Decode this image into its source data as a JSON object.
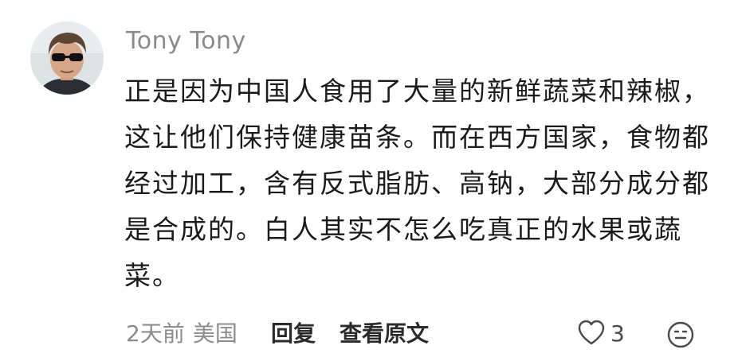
{
  "comment": {
    "username": "Tony Tony",
    "text": "正是因为中国人食用了大量的新鲜蔬菜和辣椒，这让他们保持健康苗条。而在西方国家，食物都经过加工，含有反式脂肪、高钠，大部分成分都是合成的。白人其实不怎么吃真正的水果或蔬菜。",
    "time": "2天前",
    "region": "美国",
    "reply_label": "回复",
    "view_original_label": "查看原文",
    "like_count": "3"
  },
  "icons": {
    "like": "heart-outline-icon",
    "reaction": "smiley-face-icon"
  },
  "colors": {
    "username": "#8a8a8a",
    "text": "#1b1b1b",
    "meta": "#8c8c8c",
    "action": "#2b2b2b"
  }
}
